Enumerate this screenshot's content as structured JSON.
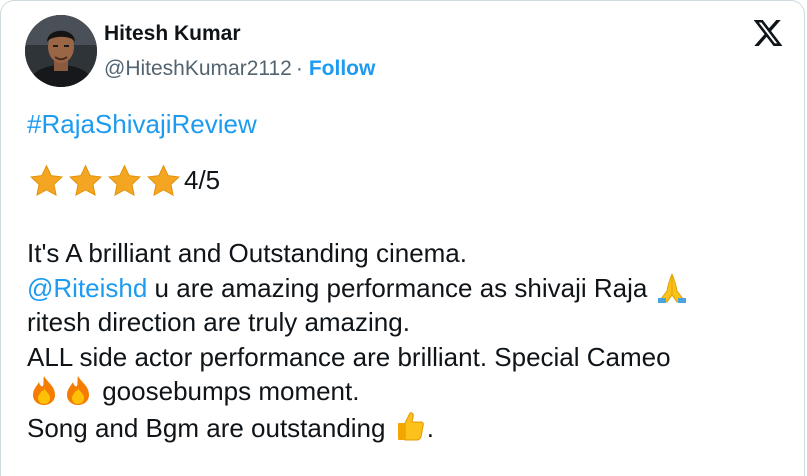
{
  "author": {
    "display_name": "Hitesh Kumar",
    "handle": "@HiteshKumar2112",
    "separator": "·",
    "follow_label": "Follow"
  },
  "brand_icon": "x-logo-icon",
  "tweet": {
    "hashtag": "#RajaShivajiReview",
    "rating": {
      "stars": 4,
      "text": "4/5"
    },
    "line1": "It's A brilliant and Outstanding cinema.",
    "line2_mention": "@Riteishd",
    "line2_text": " u are amazing performance as shivaji Raja ",
    "line3": "ritesh direction are truly amazing.",
    "line4": "ALL side actor performance are brilliant. Special Cameo",
    "line5_text": " goosebumps moment.",
    "line6_text": "Song and Bgm are outstanding ",
    "line6_end": "."
  },
  "colors": {
    "text": "#0f1419",
    "secondary": "#536471",
    "link": "#1d9bf0",
    "star": "#f4a623",
    "border": "#cfd9de"
  }
}
